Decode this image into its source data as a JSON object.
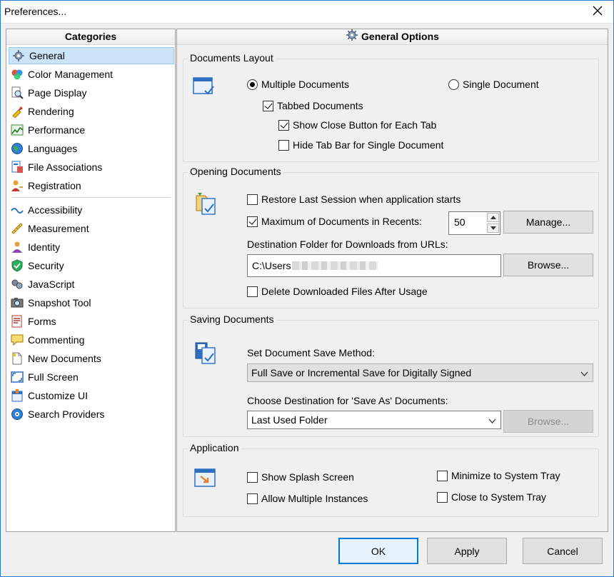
{
  "window": {
    "title": "Preferences...",
    "close_glyph": "✕"
  },
  "categories": {
    "header": "Categories",
    "items": [
      {
        "label": "General",
        "icon": "gear-icon",
        "selected": true
      },
      {
        "label": "Color Management",
        "icon": "color-balls-icon"
      },
      {
        "label": "Page Display",
        "icon": "magnifier-icon"
      },
      {
        "label": "Rendering",
        "icon": "brush-icon"
      },
      {
        "label": "Performance",
        "icon": "chart-icon"
      },
      {
        "label": "Languages",
        "icon": "globe-icon"
      },
      {
        "label": "File Associations",
        "icon": "file-assoc-icon"
      },
      {
        "label": "Registration",
        "icon": "person-key-icon"
      },
      {
        "label": "Accessibility",
        "icon": "accessibility-icon"
      },
      {
        "label": "Measurement",
        "icon": "ruler-icon"
      },
      {
        "label": "Identity",
        "icon": "identity-icon"
      },
      {
        "label": "Security",
        "icon": "shield-icon"
      },
      {
        "label": "JavaScript",
        "icon": "javascript-icon"
      },
      {
        "label": "Snapshot Tool",
        "icon": "camera-icon"
      },
      {
        "label": "Forms",
        "icon": "form-icon"
      },
      {
        "label": "Commenting",
        "icon": "comment-icon"
      },
      {
        "label": "New Documents",
        "icon": "new-document-icon"
      },
      {
        "label": "Full Screen",
        "icon": "fullscreen-icon"
      },
      {
        "label": "Customize UI",
        "icon": "customize-icon"
      },
      {
        "label": "Search Providers",
        "icon": "search-providers-icon"
      }
    ]
  },
  "general": {
    "header": "General Options",
    "documents_layout": {
      "title": "Documents Layout",
      "multiple": "Multiple Documents",
      "single": "Single Document",
      "layout_selected": "multiple",
      "tabbed": "Tabbed Documents",
      "tabbed_checked": true,
      "show_close": "Show Close Button for Each Tab",
      "show_close_checked": true,
      "hide_tab_bar": "Hide Tab Bar for Single Document",
      "hide_tab_bar_checked": false
    },
    "opening_documents": {
      "title": "Opening Documents",
      "restore_session": "Restore Last Session when application starts",
      "restore_checked": false,
      "max_recents": "Maximum of Documents in Recents:",
      "max_recents_checked": true,
      "max_recents_value": "50",
      "manage_button": "Manage...",
      "destination_label": "Destination Folder for Downloads from URLs:",
      "destination_value": "C:\\Users",
      "browse_button": "Browse...",
      "delete_downloaded": "Delete Downloaded Files After Usage",
      "delete_checked": false
    },
    "saving_documents": {
      "title": "Saving Documents",
      "save_method_label": "Set Document Save Method:",
      "save_method_value": "Full Save or Incremental Save for Digitally Signed",
      "save_as_label": "Choose Destination for 'Save As' Documents:",
      "save_as_value": "Last Used Folder",
      "browse_button": "Browse..."
    },
    "application": {
      "title": "Application",
      "splash": "Show Splash Screen",
      "multiple_instances": "Allow Multiple Instances",
      "minimize_tray": "Minimize to System Tray",
      "close_tray": "Close to System Tray"
    }
  },
  "buttons": {
    "ok": "OK",
    "apply": "Apply",
    "cancel": "Cancel"
  },
  "colors": {
    "accent": "#0078d7",
    "selection": "#cce4f7"
  }
}
